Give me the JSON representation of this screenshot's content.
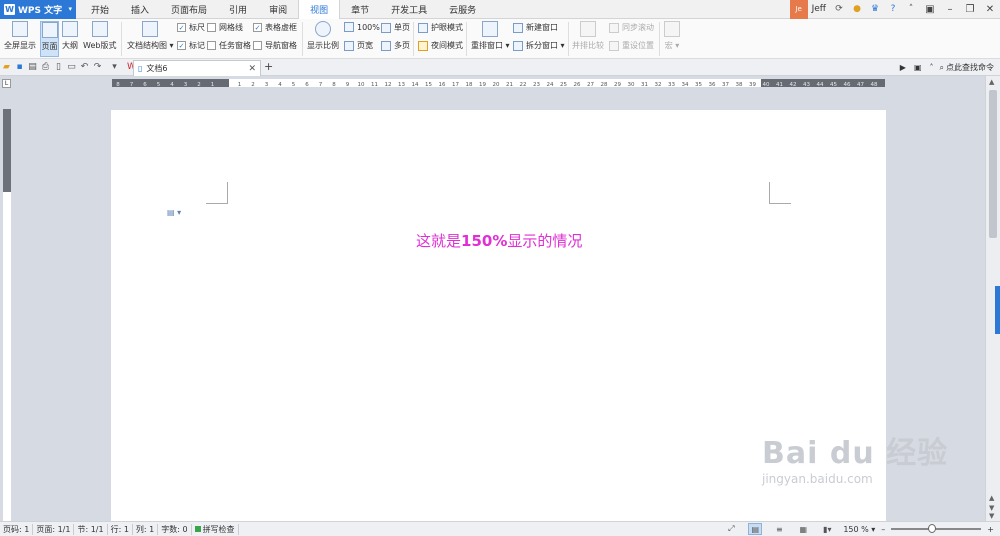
{
  "app": {
    "name": "WPS 文字"
  },
  "menu_tabs": [
    "开始",
    "插入",
    "页面布局",
    "引用",
    "审阅",
    "视图",
    "章节",
    "开发工具",
    "云服务"
  ],
  "active_tab": "视图",
  "user": {
    "avatar_text": "Je",
    "name": "Jeff"
  },
  "ribbon": {
    "fullscreen": "全屏显示",
    "page": "页面",
    "outline": "大纲",
    "web": "Web版式",
    "doc_map": "文档结构图",
    "ruler": "标尺",
    "gridlines": "网格线",
    "table_borders": "表格虚框",
    "marks": "标记",
    "task_pane": "任务窗格",
    "nav_pane": "导航窗格",
    "zoom": "显示比例",
    "zoom_100": "100%",
    "page_width": "页宽",
    "one_page": "单页",
    "multi_page": "多页",
    "eye_mode": "护眼模式",
    "night_mode": "夜间模式",
    "arrange": "重排窗口",
    "new_window": "新建窗口",
    "split": "拆分窗口",
    "side_by_side": "并排比较",
    "sync_scroll": "同步滚动",
    "reset_pos": "重设位置",
    "macro": "宏"
  },
  "quick_access": {
    "find_command": "点此查找命令"
  },
  "doc_tab": {
    "title": "文档6"
  },
  "ruler_numbers": [
    "8",
    "7",
    "6",
    "5",
    "4",
    "3",
    "2",
    "1",
    "",
    "1",
    "2",
    "3",
    "4",
    "5",
    "6",
    "7",
    "8",
    "9",
    "10",
    "11",
    "12",
    "13",
    "14",
    "15",
    "16",
    "17",
    "18",
    "19",
    "20",
    "21",
    "22",
    "23",
    "24",
    "25",
    "26",
    "27",
    "28",
    "29",
    "30",
    "31",
    "32",
    "33",
    "34",
    "35",
    "36",
    "37",
    "38",
    "39",
    "40",
    "41",
    "42",
    "43",
    "44",
    "45",
    "46",
    "47",
    "48"
  ],
  "document": {
    "text_pre": "这就是",
    "text_bold": "150%",
    "text_post": "显示的情况"
  },
  "status": {
    "page_num": "页码: 1",
    "pages": "页面: 1/1",
    "section": "节: 1/1",
    "line": "行: 1",
    "col": "列: 1",
    "words": "字数: 0",
    "spell": "拼写检查",
    "zoom": "150 %",
    "zoom_level": 0.45
  },
  "watermark": {
    "big": "Bai du 经验",
    "small": "jingyan.baidu.com"
  },
  "colors": {
    "accent": "#2b78d6",
    "doc_text": "#e02fd4"
  }
}
